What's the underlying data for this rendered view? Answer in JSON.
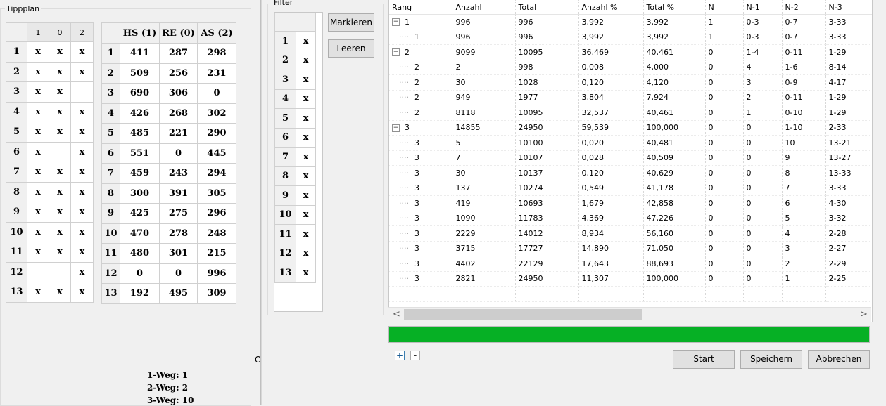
{
  "tippplan": {
    "title": "Tippplan",
    "col_headers": [
      "1",
      "0",
      "2"
    ],
    "rows": [
      {
        "n": "1",
        "c": [
          "x",
          "x",
          "x"
        ]
      },
      {
        "n": "2",
        "c": [
          "x",
          "x",
          "x"
        ]
      },
      {
        "n": "3",
        "c": [
          "x",
          "x",
          ""
        ]
      },
      {
        "n": "4",
        "c": [
          "x",
          "x",
          "x"
        ]
      },
      {
        "n": "5",
        "c": [
          "x",
          "x",
          "x"
        ]
      },
      {
        "n": "6",
        "c": [
          "x",
          "",
          "x"
        ]
      },
      {
        "n": "7",
        "c": [
          "x",
          "x",
          "x"
        ]
      },
      {
        "n": "8",
        "c": [
          "x",
          "x",
          "x"
        ]
      },
      {
        "n": "9",
        "c": [
          "x",
          "x",
          "x"
        ]
      },
      {
        "n": "10",
        "c": [
          "x",
          "x",
          "x"
        ]
      },
      {
        "n": "11",
        "c": [
          "x",
          "x",
          "x"
        ]
      },
      {
        "n": "12",
        "c": [
          "",
          "",
          "x"
        ]
      },
      {
        "n": "13",
        "c": [
          "x",
          "x",
          "x"
        ]
      }
    ]
  },
  "stats": {
    "col_headers": [
      "HS (1)",
      "RE (0)",
      "AS (2)"
    ],
    "rows": [
      {
        "n": "1",
        "c": [
          "411",
          "287",
          "298"
        ]
      },
      {
        "n": "2",
        "c": [
          "509",
          "256",
          "231"
        ]
      },
      {
        "n": "3",
        "c": [
          "690",
          "306",
          "0"
        ]
      },
      {
        "n": "4",
        "c": [
          "426",
          "268",
          "302"
        ]
      },
      {
        "n": "5",
        "c": [
          "485",
          "221",
          "290"
        ]
      },
      {
        "n": "6",
        "c": [
          "551",
          "0",
          "445"
        ]
      },
      {
        "n": "7",
        "c": [
          "459",
          "243",
          "294"
        ]
      },
      {
        "n": "8",
        "c": [
          "300",
          "391",
          "305"
        ]
      },
      {
        "n": "9",
        "c": [
          "425",
          "275",
          "296"
        ]
      },
      {
        "n": "10",
        "c": [
          "470",
          "278",
          "248"
        ]
      },
      {
        "n": "11",
        "c": [
          "480",
          "301",
          "215"
        ]
      },
      {
        "n": "12",
        "c": [
          "0",
          "0",
          "996"
        ]
      },
      {
        "n": "13",
        "c": [
          "192",
          "495",
          "309"
        ]
      }
    ]
  },
  "wege": [
    "1-Weg:  1",
    "2-Weg:  2",
    "3-Weg:  10"
  ],
  "filter": {
    "title": "Filter",
    "rows": [
      {
        "n": "1",
        "c": "x"
      },
      {
        "n": "2",
        "c": "x"
      },
      {
        "n": "3",
        "c": "x"
      },
      {
        "n": "4",
        "c": "x"
      },
      {
        "n": "5",
        "c": "x"
      },
      {
        "n": "6",
        "c": "x"
      },
      {
        "n": "7",
        "c": "x"
      },
      {
        "n": "8",
        "c": "x"
      },
      {
        "n": "9",
        "c": "x"
      },
      {
        "n": "10",
        "c": "x"
      },
      {
        "n": "11",
        "c": "x"
      },
      {
        "n": "12",
        "c": "x"
      },
      {
        "n": "13",
        "c": "x"
      }
    ],
    "mark_label": "Markieren",
    "clear_label": "Leeren"
  },
  "cut_label": "O",
  "tree": {
    "columns": [
      "Rang",
      "Anzahl",
      "Total",
      "Anzahl %",
      "Total %",
      "N",
      "N-1",
      "N-2",
      "N-3"
    ],
    "rows": [
      {
        "lvl": 0,
        "exp": "−",
        "c": [
          "1",
          "996",
          "996",
          "3,992",
          "3,992",
          "1",
          "0-3",
          "0-7",
          "3-33"
        ]
      },
      {
        "lvl": 1,
        "c": [
          "1",
          "996",
          "996",
          "3,992",
          "3,992",
          "1",
          "0-3",
          "0-7",
          "3-33"
        ]
      },
      {
        "lvl": 0,
        "exp": "−",
        "c": [
          "2",
          "9099",
          "10095",
          "36,469",
          "40,461",
          "0",
          "1-4",
          "0-11",
          "1-29"
        ]
      },
      {
        "lvl": 1,
        "c": [
          "2",
          "2",
          "998",
          "0,008",
          "4,000",
          "0",
          "4",
          "1-6",
          "8-14"
        ]
      },
      {
        "lvl": 1,
        "c": [
          "2",
          "30",
          "1028",
          "0,120",
          "4,120",
          "0",
          "3",
          "0-9",
          "4-17"
        ]
      },
      {
        "lvl": 1,
        "c": [
          "2",
          "949",
          "1977",
          "3,804",
          "7,924",
          "0",
          "2",
          "0-11",
          "1-29"
        ]
      },
      {
        "lvl": 1,
        "c": [
          "2",
          "8118",
          "10095",
          "32,537",
          "40,461",
          "0",
          "1",
          "0-10",
          "1-29"
        ]
      },
      {
        "lvl": 0,
        "exp": "−",
        "c": [
          "3",
          "14855",
          "24950",
          "59,539",
          "100,000",
          "0",
          "0",
          "1-10",
          "2-33"
        ]
      },
      {
        "lvl": 1,
        "c": [
          "3",
          "5",
          "10100",
          "0,020",
          "40,481",
          "0",
          "0",
          "10",
          "13-21"
        ]
      },
      {
        "lvl": 1,
        "c": [
          "3",
          "7",
          "10107",
          "0,028",
          "40,509",
          "0",
          "0",
          "9",
          "13-27"
        ]
      },
      {
        "lvl": 1,
        "c": [
          "3",
          "30",
          "10137",
          "0,120",
          "40,629",
          "0",
          "0",
          "8",
          "13-33"
        ]
      },
      {
        "lvl": 1,
        "c": [
          "3",
          "137",
          "10274",
          "0,549",
          "41,178",
          "0",
          "0",
          "7",
          "3-33"
        ]
      },
      {
        "lvl": 1,
        "c": [
          "3",
          "419",
          "10693",
          "1,679",
          "42,858",
          "0",
          "0",
          "6",
          "4-30"
        ]
      },
      {
        "lvl": 1,
        "c": [
          "3",
          "1090",
          "11783",
          "4,369",
          "47,226",
          "0",
          "0",
          "5",
          "3-32"
        ]
      },
      {
        "lvl": 1,
        "c": [
          "3",
          "2229",
          "14012",
          "8,934",
          "56,160",
          "0",
          "0",
          "4",
          "2-28"
        ]
      },
      {
        "lvl": 1,
        "c": [
          "3",
          "3715",
          "17727",
          "14,890",
          "71,050",
          "0",
          "0",
          "3",
          "2-27"
        ]
      },
      {
        "lvl": 1,
        "c": [
          "3",
          "4402",
          "22129",
          "17,643",
          "88,693",
          "0",
          "0",
          "2",
          "2-29"
        ]
      },
      {
        "lvl": 1,
        "c": [
          "3",
          "2821",
          "24950",
          "11,307",
          "100,000",
          "0",
          "0",
          "1",
          "2-25"
        ]
      }
    ]
  },
  "scroll": {
    "left_arrow": "<",
    "right_arrow": ">"
  },
  "progress": {
    "value": 1.0,
    "color": "#06b025"
  },
  "expand_all_label": "+",
  "collapse_all_label": "-",
  "buttons": {
    "start": "Start",
    "save": "Speichern",
    "cancel": "Abbrechen"
  }
}
